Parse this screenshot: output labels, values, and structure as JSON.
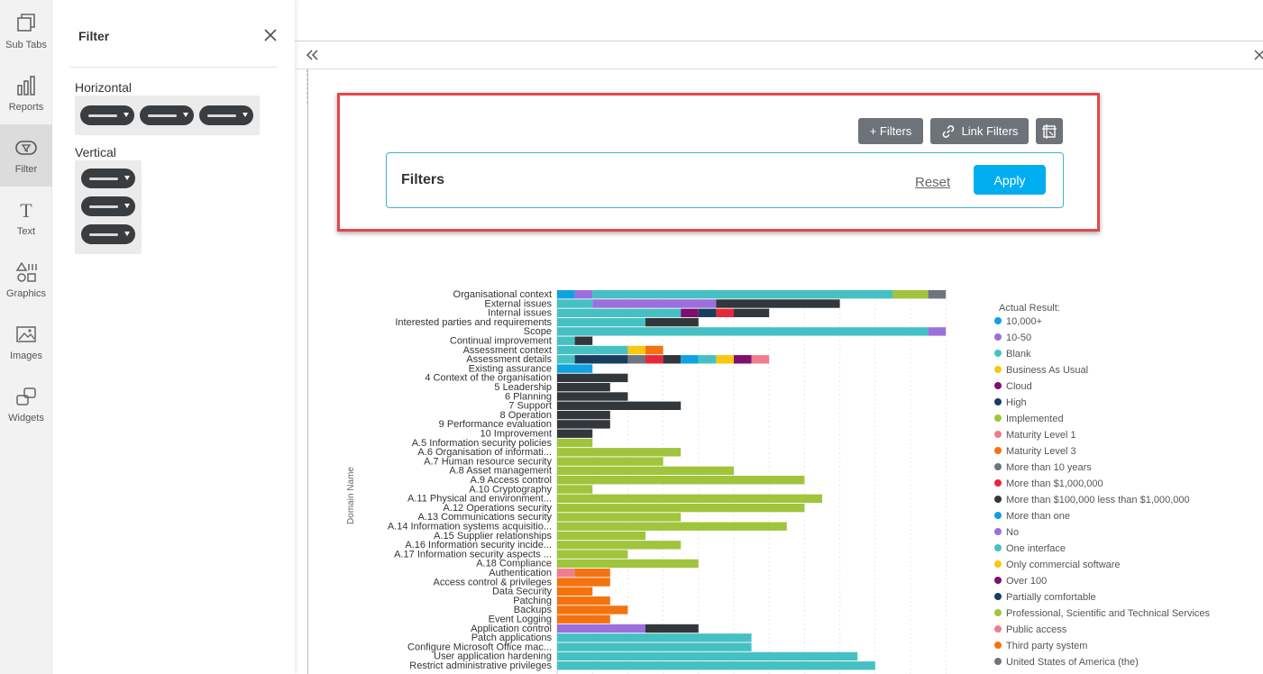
{
  "rail": {
    "items": [
      {
        "label": "Sub Tabs",
        "icon": "sub-tabs-icon"
      },
      {
        "label": "Reports",
        "icon": "bar-chart-icon"
      },
      {
        "label": "Filter",
        "icon": "filter-icon",
        "active": true
      },
      {
        "label": "Text",
        "icon": "text-icon"
      },
      {
        "label": "Graphics",
        "icon": "shapes-icon"
      },
      {
        "label": "Images",
        "icon": "image-icon"
      },
      {
        "label": "Widgets",
        "icon": "widgets-icon"
      }
    ]
  },
  "filter_panel": {
    "title": "Filter",
    "horizontal_label": "Horizontal",
    "vertical_label": "Vertical"
  },
  "widget": {
    "add_filters": "+ Filters",
    "link_filters": "Link Filters",
    "filters_title": "Filters",
    "reset": "Reset",
    "apply": "Apply"
  },
  "colors": {
    "10,000+": "#0da2e0",
    "10-50": "#9b6fdc",
    "Blank": "#46c1c3",
    "Business As Usual": "#f7c80f",
    "Cloud": "#7d0f6f",
    "High": "#193d5f",
    "Implemented": "#a0c43c",
    "Maturity Level 1": "#f07d8c",
    "Maturity Level 3": "#f5730f",
    "More than 10 years": "#6e7480",
    "More than $1,000,000": "#e6283c",
    "More than $100,000 less than $1,000,000": "#32373c",
    "More than one": "#0da2e0",
    "No": "#9b6fdc",
    "One interface": "#46c1c3",
    "Only commercial software": "#f7c80f",
    "Over 100": "#7d0f6f",
    "Partially comfortable": "#193d5f",
    "Professional, Scientific and Technical Services": "#a0c43c",
    "Public access": "#f07d8c",
    "Third party system": "#f5730f",
    "United States of America (the)": "#6e7480"
  },
  "chart_data": {
    "type": "bar",
    "orientation": "horizontal",
    "stacked": true,
    "ylabel": "Domain Name",
    "legend_title": "Actual Result:",
    "legend_position": "right",
    "legend": [
      "10,000+",
      "10-50",
      "Blank",
      "Business As Usual",
      "Cloud",
      "High",
      "Implemented",
      "Maturity Level 1",
      "Maturity Level 3",
      "More than 10 years",
      "More than $1,000,000",
      "More than $100,000 less than $1,000,000",
      "More than one",
      "No",
      "One interface",
      "Only commercial software",
      "Over 100",
      "Partially comfortable",
      "Professional, Scientific and Technical Services",
      "Public access",
      "Third party system",
      "United States of America (the)"
    ],
    "categories": [
      {
        "label": "Organisational context",
        "segments": [
          [
            "10,000+",
            1
          ],
          [
            "10-50",
            1
          ],
          [
            "Blank",
            17
          ],
          [
            "Implemented",
            2
          ],
          [
            "More than 10 years",
            1
          ]
        ]
      },
      {
        "label": "External issues",
        "segments": [
          [
            "Blank",
            2
          ],
          [
            "10-50",
            7
          ],
          [
            "More than $100,000 less than $1,000,000",
            7
          ]
        ]
      },
      {
        "label": "Internal issues",
        "segments": [
          [
            "Blank",
            7
          ],
          [
            "Cloud",
            1
          ],
          [
            "High",
            1
          ],
          [
            "More than $1,000,000",
            1
          ],
          [
            "More than $100,000 less than $1,000,000",
            2
          ]
        ]
      },
      {
        "label": "Interested parties and requirements",
        "segments": [
          [
            "Blank",
            5
          ],
          [
            "More than $100,000 less than $1,000,000",
            3
          ]
        ]
      },
      {
        "label": "Scope",
        "segments": [
          [
            "Blank",
            21
          ],
          [
            "10-50",
            1
          ]
        ]
      },
      {
        "label": "Continual improvement",
        "segments": [
          [
            "Blank",
            1
          ],
          [
            "More than $100,000 less than $1,000,000",
            1
          ]
        ]
      },
      {
        "label": "Assessment context",
        "segments": [
          [
            "Blank",
            4
          ],
          [
            "Business As Usual",
            1
          ],
          [
            "Maturity Level 3",
            1
          ]
        ]
      },
      {
        "label": "Assessment details",
        "segments": [
          [
            "Blank",
            1
          ],
          [
            "High",
            3
          ],
          [
            "More than 10 years",
            1
          ],
          [
            "More than $1,000,000",
            1
          ],
          [
            "More than $100,000 less than $1,000,000",
            1
          ],
          [
            "More than one",
            1
          ],
          [
            "One interface",
            1
          ],
          [
            "Only commercial software",
            1
          ],
          [
            "Over 100",
            1
          ],
          [
            "Public access",
            1
          ]
        ]
      },
      {
        "label": "Existing assurance",
        "segments": [
          [
            "10,000+",
            2
          ]
        ]
      },
      {
        "label": "4 Context of the organisation",
        "segments": [
          [
            "More than $100,000 less than $1,000,000",
            4
          ]
        ]
      },
      {
        "label": "5 Leadership",
        "segments": [
          [
            "More than $100,000 less than $1,000,000",
            3
          ]
        ]
      },
      {
        "label": "6 Planning",
        "segments": [
          [
            "More than $100,000 less than $1,000,000",
            4
          ]
        ]
      },
      {
        "label": "7 Support",
        "segments": [
          [
            "More than $100,000 less than $1,000,000",
            7
          ]
        ]
      },
      {
        "label": "8 Operation",
        "segments": [
          [
            "More than $100,000 less than $1,000,000",
            3
          ]
        ]
      },
      {
        "label": "9 Performance evaluation",
        "segments": [
          [
            "More than $100,000 less than $1,000,000",
            3
          ]
        ]
      },
      {
        "label": "10 Improvement",
        "segments": [
          [
            "More than $100,000 less than $1,000,000",
            2
          ]
        ]
      },
      {
        "label": "A.5 Information security policies",
        "segments": [
          [
            "Implemented",
            2
          ]
        ]
      },
      {
        "label": "A.6 Organisation of informati...",
        "segments": [
          [
            "Implemented",
            7
          ]
        ]
      },
      {
        "label": "A.7 Human resource security",
        "segments": [
          [
            "Implemented",
            6
          ]
        ]
      },
      {
        "label": "A.8 Asset management",
        "segments": [
          [
            "Implemented",
            10
          ]
        ]
      },
      {
        "label": "A.9 Access control",
        "segments": [
          [
            "Implemented",
            14
          ]
        ]
      },
      {
        "label": "A.10 Cryptography",
        "segments": [
          [
            "Implemented",
            2
          ]
        ]
      },
      {
        "label": "A.11 Physical and environment...",
        "segments": [
          [
            "Implemented",
            15
          ]
        ]
      },
      {
        "label": "A.12 Operations security",
        "segments": [
          [
            "Implemented",
            14
          ]
        ]
      },
      {
        "label": "A.13 Communications security",
        "segments": [
          [
            "Implemented",
            7
          ]
        ]
      },
      {
        "label": "A.14 Information systems acquisitio...",
        "segments": [
          [
            "Implemented",
            13
          ]
        ]
      },
      {
        "label": "A.15 Supplier relationships",
        "segments": [
          [
            "Implemented",
            5
          ]
        ]
      },
      {
        "label": "A.16 Information security incide...",
        "segments": [
          [
            "Implemented",
            7
          ]
        ]
      },
      {
        "label": "A.17 Information security aspects ...",
        "segments": [
          [
            "Implemented",
            4
          ]
        ]
      },
      {
        "label": "A.18 Compliance",
        "segments": [
          [
            "Implemented",
            8
          ]
        ]
      },
      {
        "label": "Authentication",
        "segments": [
          [
            "Maturity Level 1",
            1
          ],
          [
            "Maturity Level 3",
            2
          ]
        ]
      },
      {
        "label": "Access control & privileges",
        "segments": [
          [
            "Maturity Level 3",
            3
          ]
        ]
      },
      {
        "label": "Data Security",
        "segments": [
          [
            "Maturity Level 3",
            2
          ]
        ]
      },
      {
        "label": "Patching",
        "segments": [
          [
            "Maturity Level 3",
            3
          ]
        ]
      },
      {
        "label": "Backups",
        "segments": [
          [
            "Maturity Level 3",
            4
          ]
        ]
      },
      {
        "label": "Event Logging",
        "segments": [
          [
            "Maturity Level 3",
            3
          ]
        ]
      },
      {
        "label": "Application control",
        "segments": [
          [
            "10-50",
            5
          ],
          [
            "More than $100,000 less than $1,000,000",
            3
          ]
        ]
      },
      {
        "label": "Patch applications",
        "segments": [
          [
            "Blank",
            11
          ]
        ]
      },
      {
        "label": "Configure Microsoft Office mac...",
        "segments": [
          [
            "Blank",
            11
          ]
        ]
      },
      {
        "label": "User application hardening",
        "segments": [
          [
            "Blank",
            17
          ]
        ]
      },
      {
        "label": "Restrict administrative privileges",
        "segments": [
          [
            "Blank",
            18
          ]
        ]
      }
    ]
  }
}
